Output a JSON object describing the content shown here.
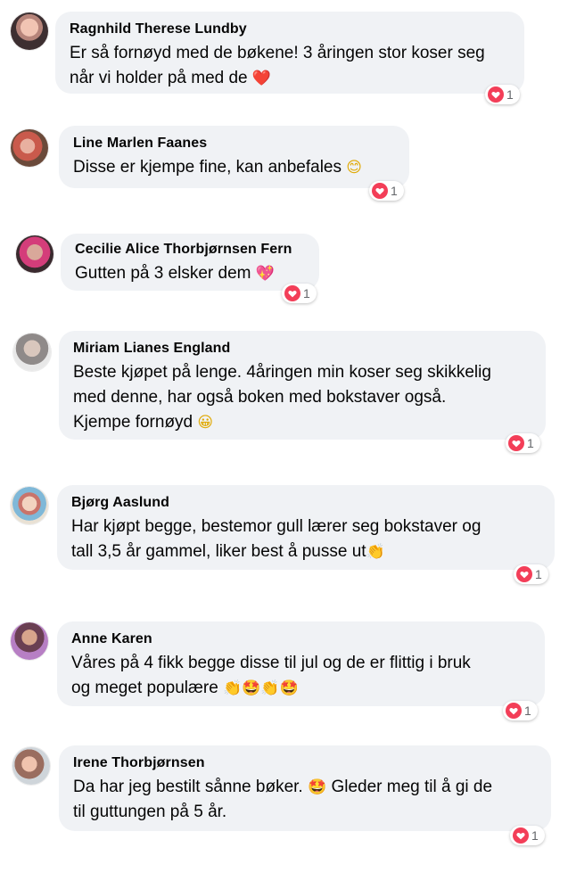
{
  "colors": {
    "bubble": "#f0f2f5",
    "heart": "#f33e58",
    "count": "#65676b"
  },
  "comments": [
    {
      "author": "Ragnhild Therese Lundby",
      "lines": [
        "Er så fornøyd med de bøkene! 3 åringen stor koser seg",
        "når vi holder på med de"
      ],
      "emojis": [
        "❤️"
      ],
      "reaction_icon": "heart-icon",
      "reaction_count": "1",
      "avatar_icon": "avatar-icon"
    },
    {
      "author": "Line Marlen Faanes",
      "lines": [
        "Disse er kjempe fine, kan anbefales"
      ],
      "emojis": [
        "😊"
      ],
      "reaction_icon": "heart-icon",
      "reaction_count": "1",
      "avatar_icon": "avatar-icon"
    },
    {
      "author": "Cecilie Alice Thorbjørnsen Fern",
      "lines": [
        "Gutten på 3 elsker dem"
      ],
      "emojis": [
        "💖"
      ],
      "reaction_icon": "heart-icon",
      "reaction_count": "1",
      "avatar_icon": "avatar-icon"
    },
    {
      "author": "Miriam Lianes England",
      "lines": [
        "Beste kjøpet på lenge. 4åringen min koser seg skikkelig",
        "med denne, har også boken med bokstaver også.",
        "Kjempe fornøyd"
      ],
      "emojis": [
        "😀"
      ],
      "reaction_icon": "heart-icon",
      "reaction_count": "1",
      "avatar_icon": "avatar-icon"
    },
    {
      "author": "Bjørg Aaslund",
      "lines": [
        "Har kjøpt begge, bestemor gull lærer seg bokstaver og",
        "tall 3,5 år gammel, liker best å pusse ut"
      ],
      "emojis": [
        "👏"
      ],
      "reaction_icon": "heart-icon",
      "reaction_count": "1",
      "avatar_icon": "avatar-icon"
    },
    {
      "author": "Anne Karen",
      "lines": [
        "Våres på 4 fikk begge disse til jul og de er flittig i bruk",
        "og meget populære"
      ],
      "emojis": [
        "👏",
        "🤩",
        "👏",
        "🤩"
      ],
      "reaction_icon": "heart-icon",
      "reaction_count": "1",
      "avatar_icon": "avatar-icon"
    },
    {
      "author": "Irene Thorbjørnsen",
      "lines": [
        "Da har jeg bestilt sånne bøker.",
        "Gleder meg til å gi de",
        "til guttungen på 5 år."
      ],
      "emojis": [
        "🤩"
      ],
      "reaction_icon": "heart-icon",
      "reaction_count": "1",
      "avatar_icon": "avatar-icon"
    }
  ]
}
